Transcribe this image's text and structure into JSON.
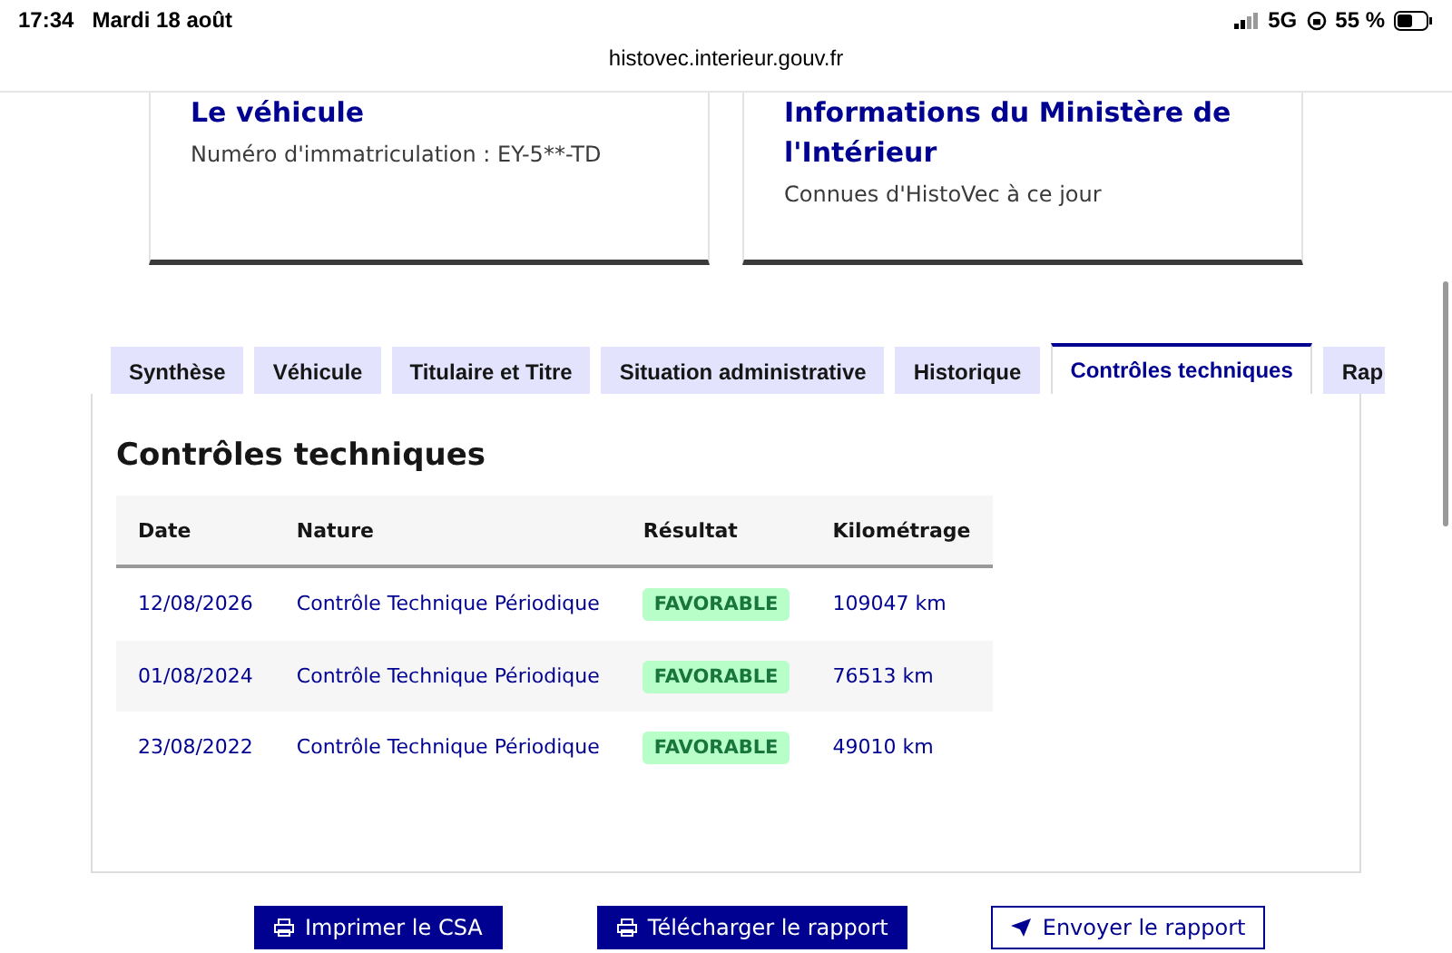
{
  "status_bar": {
    "time": "17:34",
    "date": "Mardi 18 août",
    "network": "5G",
    "battery": "55 %"
  },
  "url": "histovec.interieur.gouv.fr",
  "cards": [
    {
      "title": "Le véhicule",
      "text": "Numéro d'immatriculation : EY-5**-TD"
    },
    {
      "title": "Informations du Ministère de l'Intérieur",
      "text": "Connues d'HistoVec à ce jour"
    }
  ],
  "tabs": [
    {
      "label": "Synthèse",
      "selected": false
    },
    {
      "label": "Véhicule",
      "selected": false
    },
    {
      "label": "Titulaire et Titre",
      "selected": false
    },
    {
      "label": "Situation administrative",
      "selected": false
    },
    {
      "label": "Historique",
      "selected": false
    },
    {
      "label": "Contrôles techniques",
      "selected": true
    },
    {
      "label": "Rap",
      "selected": false
    }
  ],
  "panel": {
    "title": "Contrôles techniques",
    "table": {
      "columns": [
        "Date",
        "Nature",
        "Résultat",
        "Kilométrage"
      ],
      "rows": [
        [
          "12/08/2026",
          "Contrôle Technique Périodique",
          "FAVORABLE",
          "109047 km"
        ],
        [
          "01/08/2024",
          "Contrôle Technique Périodique",
          "FAVORABLE",
          "76513 km"
        ],
        [
          "23/08/2022",
          "Contrôle Technique Périodique",
          "FAVORABLE",
          "49010 km"
        ]
      ]
    }
  },
  "buttons": [
    {
      "label": "Imprimer le CSA",
      "kind": "primary"
    },
    {
      "label": "Télécharger le rapport",
      "kind": "primary"
    },
    {
      "label": "Envoyer le rapport",
      "kind": "secondary"
    }
  ]
}
